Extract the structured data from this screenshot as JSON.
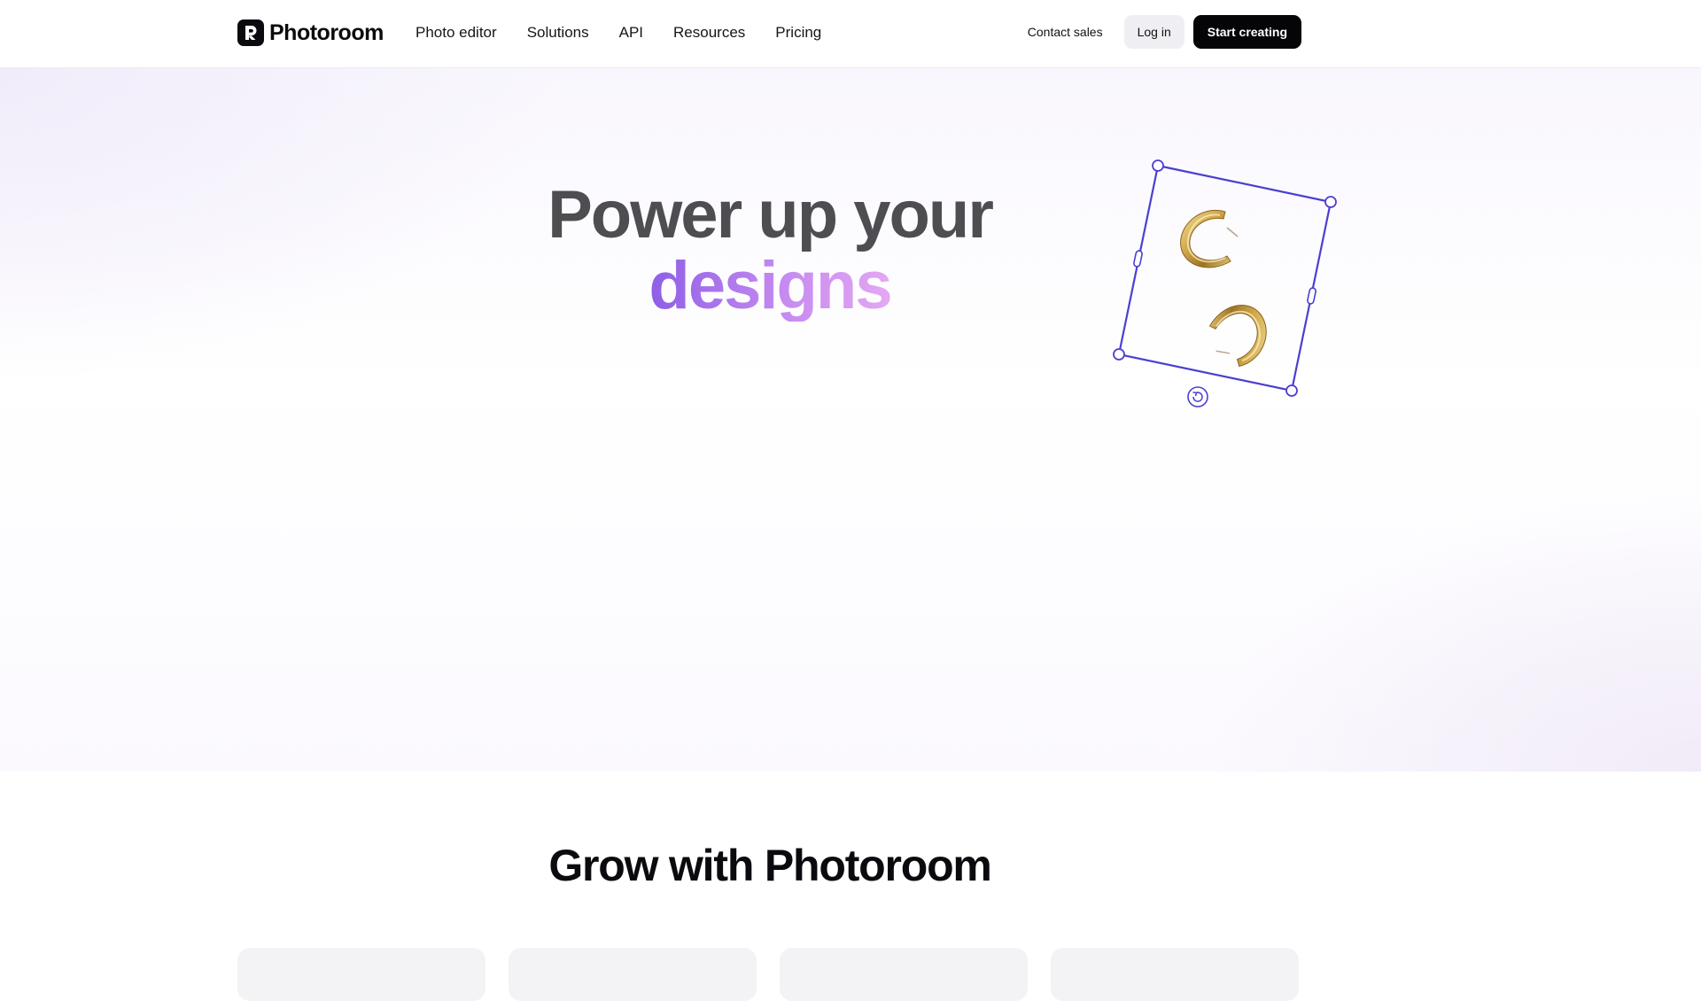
{
  "brand": {
    "name": "Photoroom"
  },
  "nav": {
    "items": [
      {
        "label": "Photo editor"
      },
      {
        "label": "Solutions"
      },
      {
        "label": "API"
      },
      {
        "label": "Resources"
      },
      {
        "label": "Pricing"
      }
    ]
  },
  "actions": {
    "contact_label": "Contact sales",
    "login_label": "Log in",
    "start_label": "Start creating"
  },
  "hero": {
    "title_line1": "Power up your",
    "title_line2": "designs",
    "image_icon": "gold-hoop-earrings",
    "accent_color": "#4b3fd0"
  },
  "section": {
    "title": "Grow with Photoroom"
  },
  "colors": {
    "primary_button": "#050507",
    "secondary_button": "#efeff3",
    "title_gray": "#4d4d52",
    "gradient_start": "#8d5ee6",
    "gradient_end": "#e4a8f3"
  }
}
